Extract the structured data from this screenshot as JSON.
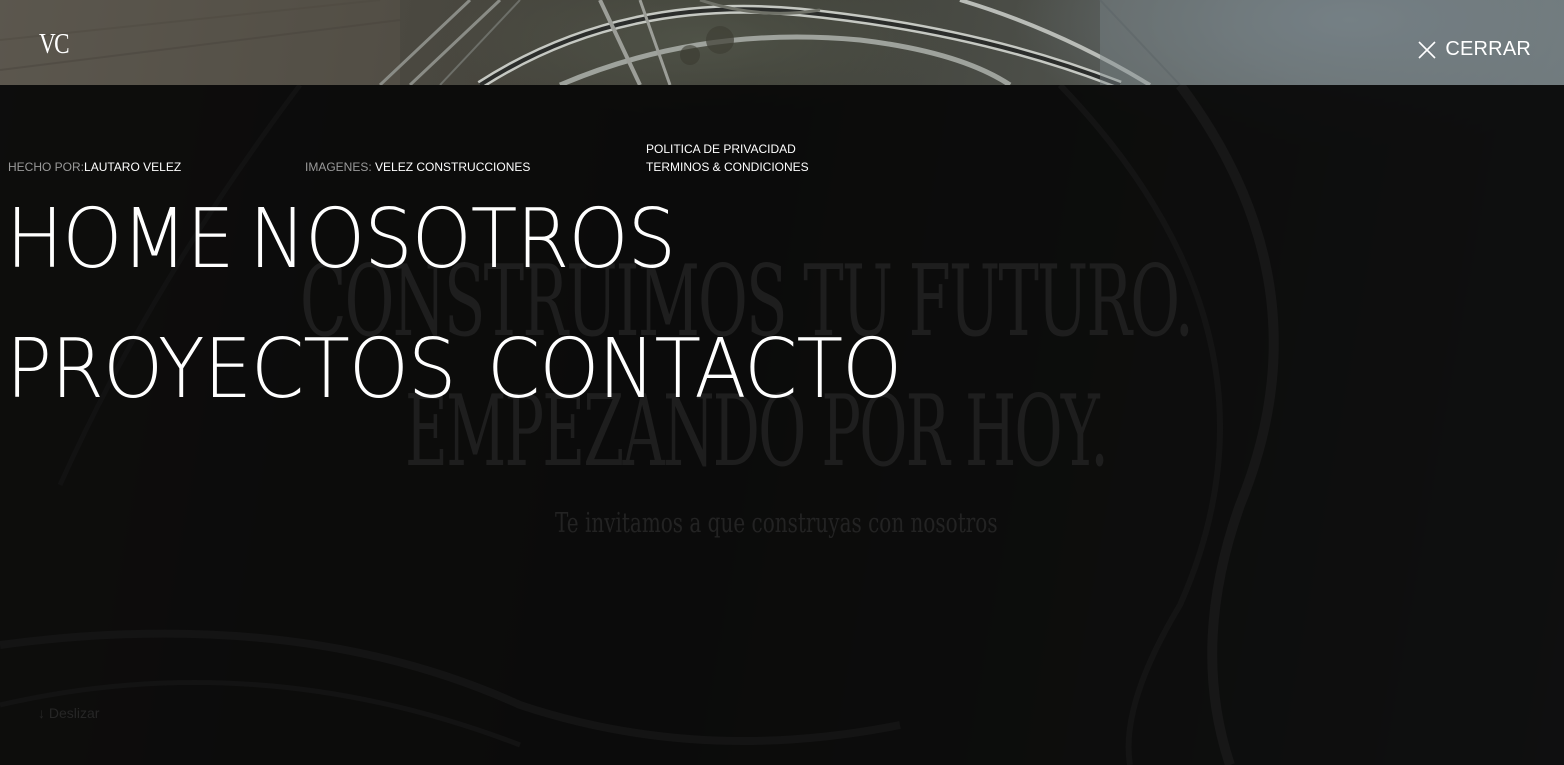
{
  "brand": {
    "logo_text": "VC"
  },
  "header": {
    "close_label": "CERRAR",
    "close_icon": "close-icon"
  },
  "credits": {
    "made_by_label": "HECHO POR:",
    "made_by_value": "LAUTARO VELEZ",
    "images_label": "IMAGENES: ",
    "images_value": "VELEZ CONSTRUCCIONES"
  },
  "legal": {
    "privacy": "POLITICA DE PRIVACIDAD",
    "terms": "TERMINOS & CONDICIONES"
  },
  "nav": {
    "home": "HOME",
    "about": "NOSOTROS",
    "projects": "PROYECTOS",
    "contact": "CONTACTO"
  },
  "hero": {
    "headline_line1": "CONSTRUIMOS TU FUTURO.",
    "headline_line2": "EMPEZANDO POR HOY.",
    "subtitle": "Te invitamos a que construyas con nosotros",
    "scroll_hint": "Deslizar",
    "scroll_icon": "arrow-down-icon"
  },
  "colors": {
    "overlay": "#080808",
    "text": "#ffffff",
    "muted_label": "#9a9a9a"
  }
}
